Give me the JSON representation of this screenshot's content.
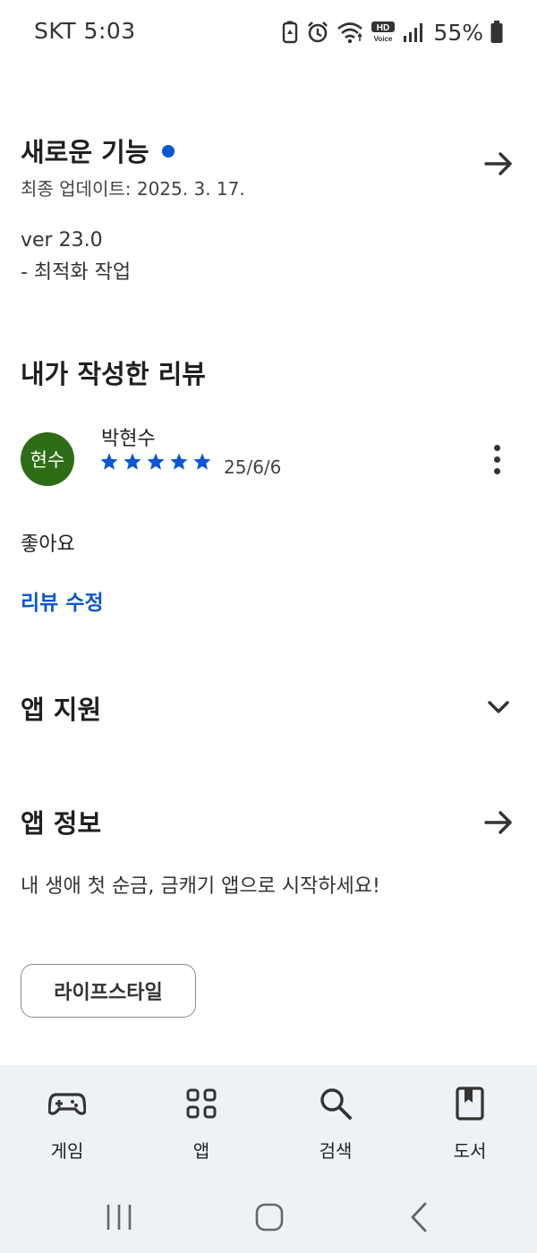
{
  "status_bar": {
    "carrier_time": "SKT 5:03",
    "battery": "55%",
    "icons": [
      "battery-saver-icon",
      "alarm-icon",
      "wifi-icon",
      "hd-voice-icon",
      "signal-icon",
      "battery-icon"
    ]
  },
  "whats_new": {
    "title": "새로운 기능",
    "updated": "최종 업데이트: 2025. 3. 17.",
    "version": "ver 23.0",
    "note": "- 최적화 작업"
  },
  "my_review": {
    "title": "내가 작성한 리뷰",
    "avatar_text": "현수",
    "reviewer": "박현수",
    "rating": 5,
    "date": "25/6/6",
    "text": "좋아요",
    "edit_label": "리뷰 수정"
  },
  "app_support": {
    "title": "앱 지원"
  },
  "app_info": {
    "title": "앱 정보",
    "description": "내 생애 첫 순금, 금캐기 앱으로 시작하세요!",
    "category_chip": "라이프스타일"
  },
  "bottom_nav": {
    "items": [
      {
        "label": "게임",
        "icon": "gamepad-icon"
      },
      {
        "label": "앱",
        "icon": "apps-grid-icon"
      },
      {
        "label": "검색",
        "icon": "search-icon"
      },
      {
        "label": "도서",
        "icon": "book-icon"
      }
    ]
  },
  "colors": {
    "accent": "#0b57d0",
    "avatar": "#2e6d16",
    "nav_background": "#eef1f5"
  }
}
